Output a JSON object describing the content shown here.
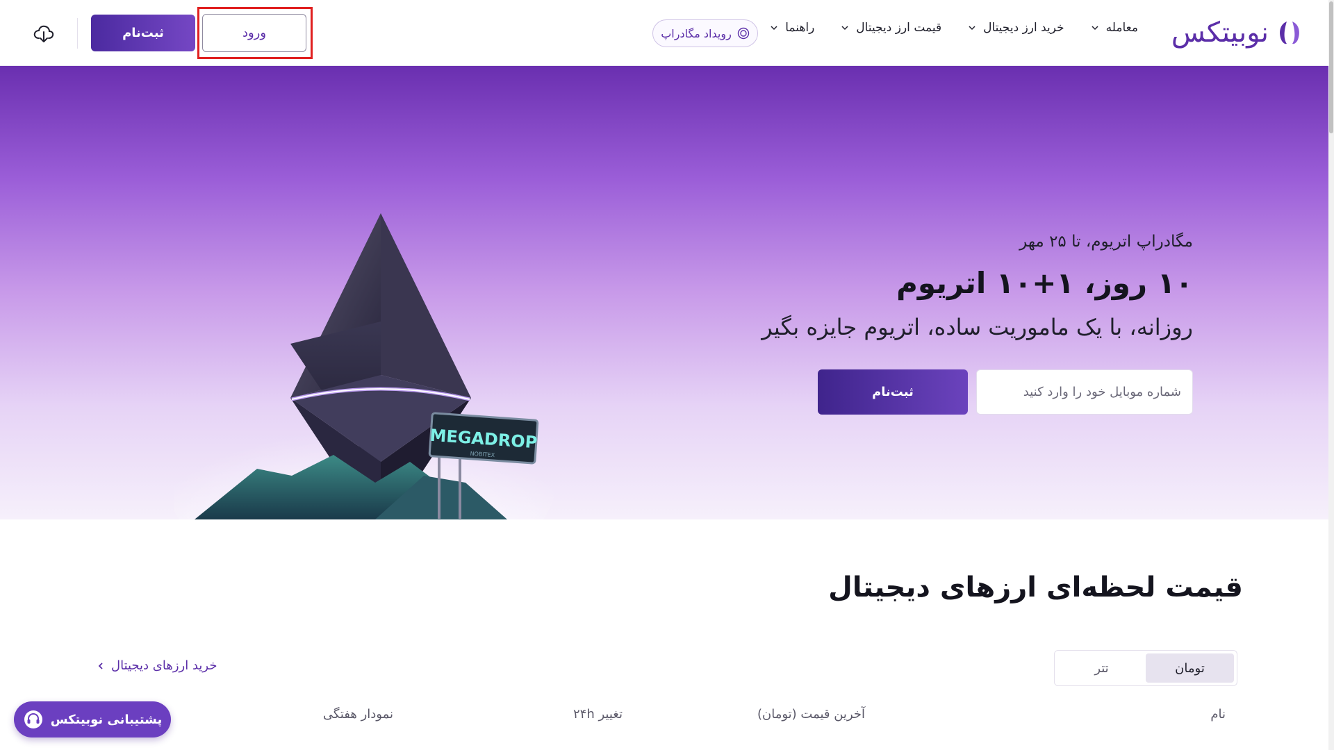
{
  "header": {
    "logo_text": "نوبیتکس",
    "nav": [
      {
        "label": "معامله"
      },
      {
        "label": "خرید ارز دیجیتال"
      },
      {
        "label": "قیمت ارز دیجیتال"
      },
      {
        "label": "راهنما"
      }
    ],
    "event_label": "رویداد مگادراپ",
    "login_label": "ورود",
    "register_label": "ثبت‌نام"
  },
  "hero": {
    "subtitle": "مگادراپ اتریوم، تا ۲۵ مهر",
    "title": "۱۰ روز، ۱+۱۰ اتریوم",
    "description": "روزانه، با یک ماموریت ساده، اتریوم جایزه بگیر",
    "phone_placeholder": "شماره موبایل خود را وارد کنید",
    "register_label": "ثبت‌نام",
    "sign_text": "MEGADROP",
    "sign_subtext": "NOBITEX"
  },
  "prices": {
    "title": "قیمت لحظه‌ای ارزهای دیجیتال",
    "toggle": [
      {
        "label": "تومان",
        "active": true
      },
      {
        "label": "تتر",
        "active": false
      }
    ],
    "buy_link": "خرید ارزهای دیجیتال",
    "columns": {
      "name": "نام",
      "price": "آخرین قیمت (تومان)",
      "change": "تغییر ۲۴h",
      "chart": "نمودار هفتگی"
    }
  },
  "support": {
    "label": "پشتیبانی نوبیتکس"
  },
  "colors": {
    "brand": "#5b2ea8",
    "brand_gradient_start": "#4b2aa0",
    "brand_gradient_end": "#7547c4",
    "highlight": "#e02020"
  }
}
